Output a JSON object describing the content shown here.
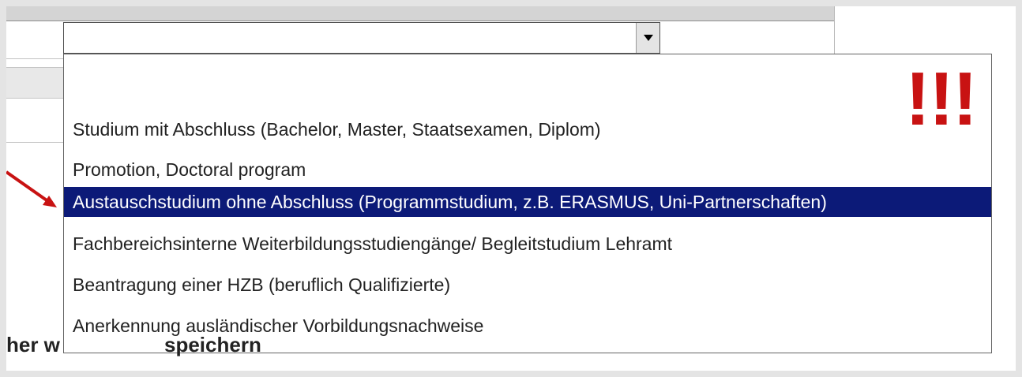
{
  "dropdown": {
    "selected_value": "",
    "options": [
      "",
      "Studium mit Abschluss (Bachelor, Master, Staatsexamen, Diplom)",
      "Promotion, Doctoral program",
      "Austauschstudium ohne Abschluss (Programmstudium, z.B. ERASMUS, Uni-Partnerschaften)",
      "Fachbereichsinterne Weiterbildungsstudiengänge/ Begleitstudium Lehramt",
      "Beantragung einer HZB (beruflich Qualifizierte)",
      "Anerkennung ausländischer Vorbildungsnachweise"
    ],
    "highlighted_index": 3,
    "arrow_icon": "chevron-down-icon"
  },
  "annotation": {
    "exclamation": "!!!",
    "color": "#c81212"
  },
  "background_text": {
    "visible_start": "her w",
    "visible_end": "speichern"
  },
  "colors": {
    "highlight": "#0c1a78"
  }
}
